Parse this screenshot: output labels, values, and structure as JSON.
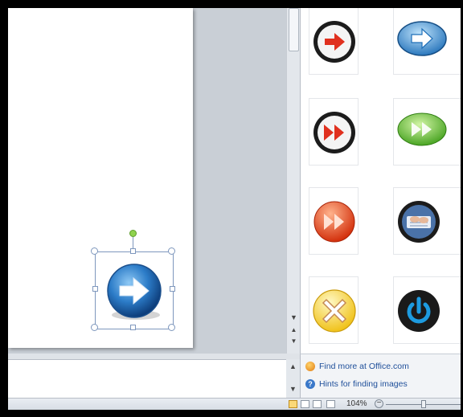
{
  "task_pane": {
    "links": {
      "find_more": "Find more at Office.com",
      "hints": "Hints for finding images"
    },
    "clip_items": [
      {
        "name": "red-arrow-circle-clip"
      },
      {
        "name": "blue-arrow-oval-clip"
      },
      {
        "name": "red-fast-forward-clip"
      },
      {
        "name": "green-fast-forward-clip"
      },
      {
        "name": "orange-fast-forward-clip"
      },
      {
        "name": "keyboard-hands-clip"
      },
      {
        "name": "yellow-x-clip"
      },
      {
        "name": "blue-power-clip"
      }
    ]
  },
  "status_bar": {
    "zoom": "104%",
    "zoom_out": "−"
  },
  "colors": {
    "link": "#1f4f9a",
    "selection": "#7e97bd",
    "rotation_handle": "#8fd24e"
  }
}
